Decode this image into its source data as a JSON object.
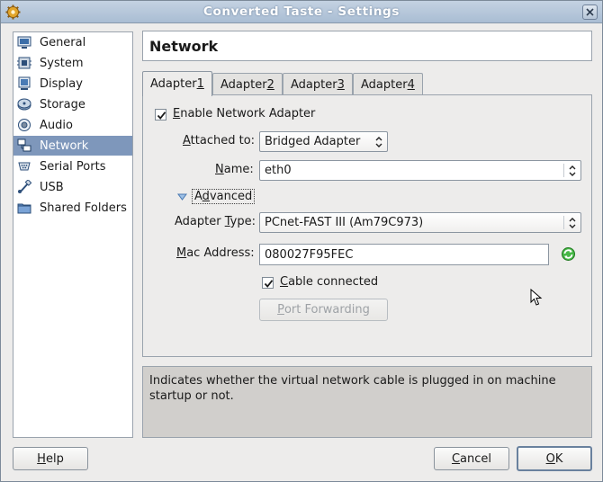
{
  "window": {
    "title": "Converted Taste - Settings"
  },
  "sidebar": {
    "items": [
      {
        "label": "General",
        "icon": "general-icon"
      },
      {
        "label": "System",
        "icon": "system-icon"
      },
      {
        "label": "Display",
        "icon": "display-icon"
      },
      {
        "label": "Storage",
        "icon": "storage-icon"
      },
      {
        "label": "Audio",
        "icon": "audio-icon"
      },
      {
        "label": "Network",
        "icon": "network-icon",
        "selected": true
      },
      {
        "label": "Serial Ports",
        "icon": "serial-ports-icon"
      },
      {
        "label": "USB",
        "icon": "usb-icon"
      },
      {
        "label": "Shared Folders",
        "icon": "shared-folders-icon"
      }
    ]
  },
  "page": {
    "title": "Network"
  },
  "tabs": [
    {
      "prefix": "Adapter ",
      "mnemonic": "1",
      "active": true
    },
    {
      "prefix": "Adapter ",
      "mnemonic": "2"
    },
    {
      "prefix": "Adapter ",
      "mnemonic": "3"
    },
    {
      "prefix": "Adapter ",
      "mnemonic": "4"
    }
  ],
  "adapter": {
    "enable_prefix": "",
    "enable_mnemonic": "E",
    "enable_rest": "nable Network Adapter",
    "enable_checked": true,
    "attached_label_mn": "A",
    "attached_label_rest": "ttached to:",
    "attached_value": "Bridged Adapter",
    "name_label_mn": "N",
    "name_label_rest": "ame:",
    "name_value": "eth0",
    "advanced_pre": "A",
    "advanced_mn": "d",
    "advanced_rest": "vanced",
    "adapter_type_label_pre": "Adapter ",
    "adapter_type_label_mn": "T",
    "adapter_type_label_rest": "ype:",
    "adapter_type_value": "PCnet-FAST III (Am79C973)",
    "mac_label_mn": "M",
    "mac_label_rest": "ac Address:",
    "mac_value": "080027F95FEC",
    "cable_mn": "C",
    "cable_rest": "able connected",
    "cable_checked": true,
    "port_forwarding_mn": "P",
    "port_forwarding_rest": "ort Forwarding"
  },
  "info": {
    "text": "Indicates whether the virtual network cable is plugged in on machine startup or not."
  },
  "buttons": {
    "help_mn": "H",
    "help_rest": "elp",
    "cancel_mn": "C",
    "cancel_rest": "ancel",
    "ok_mn": "O",
    "ok_rest": "K"
  },
  "colors": {
    "selection": "#7e97bb",
    "titlebar": "#b3c4d8",
    "refresh_icon": "#2f9e2f"
  }
}
